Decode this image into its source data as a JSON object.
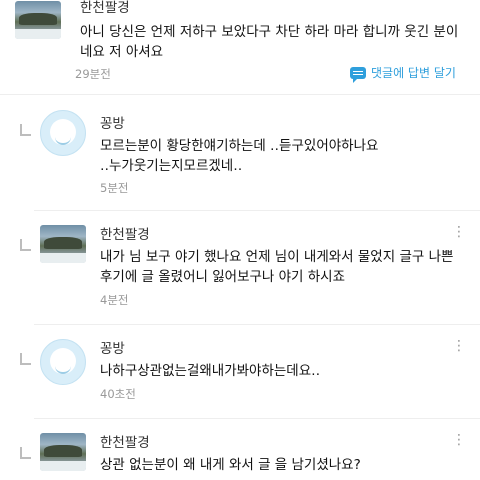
{
  "comments": [
    {
      "author": "한천팔경",
      "text": "아니 당신은 언제 저하구 보았다구 차단 하라 마라 합니까 웃긴 분이네요 저 아셔요",
      "time": "29분전",
      "reply_label": "댓글에 답변 달기",
      "avatar": "landscape-photo"
    },
    {
      "author": "꽁방",
      "text": "모르는분이 황당한얘기하는데 ‥듣구있어야하나요 ‥누가웃기는지모르겠네‥",
      "time": "5분전",
      "avatar": "default-profile"
    },
    {
      "author": "한천팔경",
      "text": "내가 님 보구 야기 했나요 언제 님이 내게와서 물었지 글구 나쁜 후기에 글 올렸어니 잃어보구나 야기 하시죠",
      "time": "4분전",
      "avatar": "landscape-photo"
    },
    {
      "author": "꽁방",
      "text": "나하구상관없는걸왜내가봐야하는데요‥",
      "time": "40초전",
      "avatar": "default-profile"
    },
    {
      "author": "한천팔경",
      "text": "상관 없는분이 왜 내게 와서 글 을 남기셨나요?",
      "time": "",
      "avatar": "landscape-photo"
    }
  ],
  "icons": {
    "more": "kebab-menu-icon",
    "reply": "reply-arrow-icon",
    "comment": "comment-bubble-icon"
  },
  "colors": {
    "accent": "#2f9fdc",
    "time_text": "#999999",
    "divider": "#eeeeee"
  }
}
